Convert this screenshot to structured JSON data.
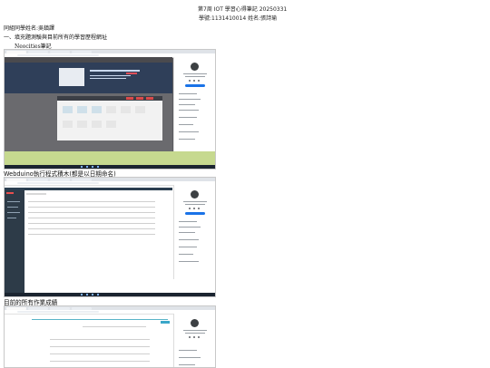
{
  "header": {
    "title": "第7周 IOT 學習心得筆記 20250331",
    "student_line": "學號:1131410014      姓名:張詩瑜"
  },
  "sections": {
    "classmates": "同組同學姓名:吳鎮譯",
    "task_one": "一、填充題測驗與目前所有的學習歷程網址",
    "neocities": "Neocities筆記",
    "webduino": "Webduino執行程式積木(都是以日期命名)",
    "grades": "目前的所有作業成績"
  }
}
